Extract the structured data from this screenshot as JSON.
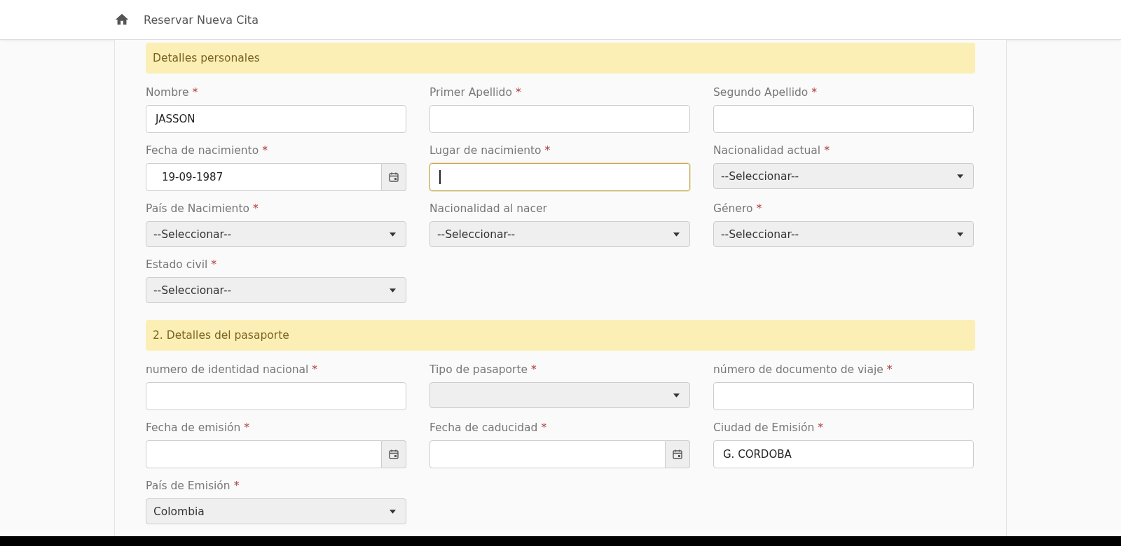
{
  "header": {
    "title": "Reservar Nueva Cita"
  },
  "sections": [
    {
      "title": "Detalles personales",
      "fields": [
        {
          "label": "Nombre",
          "marker": "*",
          "kind": "text",
          "value": "JASSON",
          "focused": false
        },
        {
          "label": "Primer Apellido",
          "marker": "*",
          "kind": "text",
          "focused": false
        },
        {
          "label": "Segundo Apellido",
          "marker": "*",
          "kind": "text",
          "focused": false
        },
        {
          "label": "Fecha de nacimiento",
          "marker": "*",
          "kind": "date",
          "value": "19-09-1987"
        },
        {
          "label": "Lugar de nacimiento",
          "marker": "*",
          "kind": "text",
          "focused": true
        },
        {
          "label": "Nacionalidad actual",
          "marker": "*",
          "kind": "select",
          "value": "--Seleccionar--"
        },
        {
          "label": "País de Nacimiento",
          "marker": "*",
          "kind": "select",
          "value": "--Seleccionar--"
        },
        {
          "label": "Nacionalidad al nacer",
          "kind": "select",
          "value": "--Seleccionar--"
        },
        {
          "label": "Género",
          "marker": "*",
          "kind": "select",
          "value": "--Seleccionar--"
        },
        {
          "label": "Estado civil",
          "marker": "*",
          "kind": "select",
          "value": "--Seleccionar--"
        }
      ]
    },
    {
      "title": "2. Detalles del pasaporte",
      "fields": [
        {
          "label": "numero de identidad nacional",
          "marker": "*",
          "kind": "text",
          "focused": false
        },
        {
          "label": "Tipo de pasaporte",
          "marker": "*",
          "kind": "select"
        },
        {
          "label": "número de documento de viaje",
          "marker": "*",
          "kind": "text",
          "focused": false
        },
        {
          "label": "Fecha de emisión",
          "marker": "*",
          "kind": "date"
        },
        {
          "label": "Fecha de caducidad",
          "marker": "*",
          "kind": "date"
        },
        {
          "label": "Ciudad de Emisión",
          "marker": "*",
          "kind": "text",
          "value": "G. CORDOBA",
          "focused": false
        },
        {
          "label": "País de Emisión",
          "marker": "*",
          "kind": "select",
          "value": "Colombia"
        }
      ]
    }
  ]
}
